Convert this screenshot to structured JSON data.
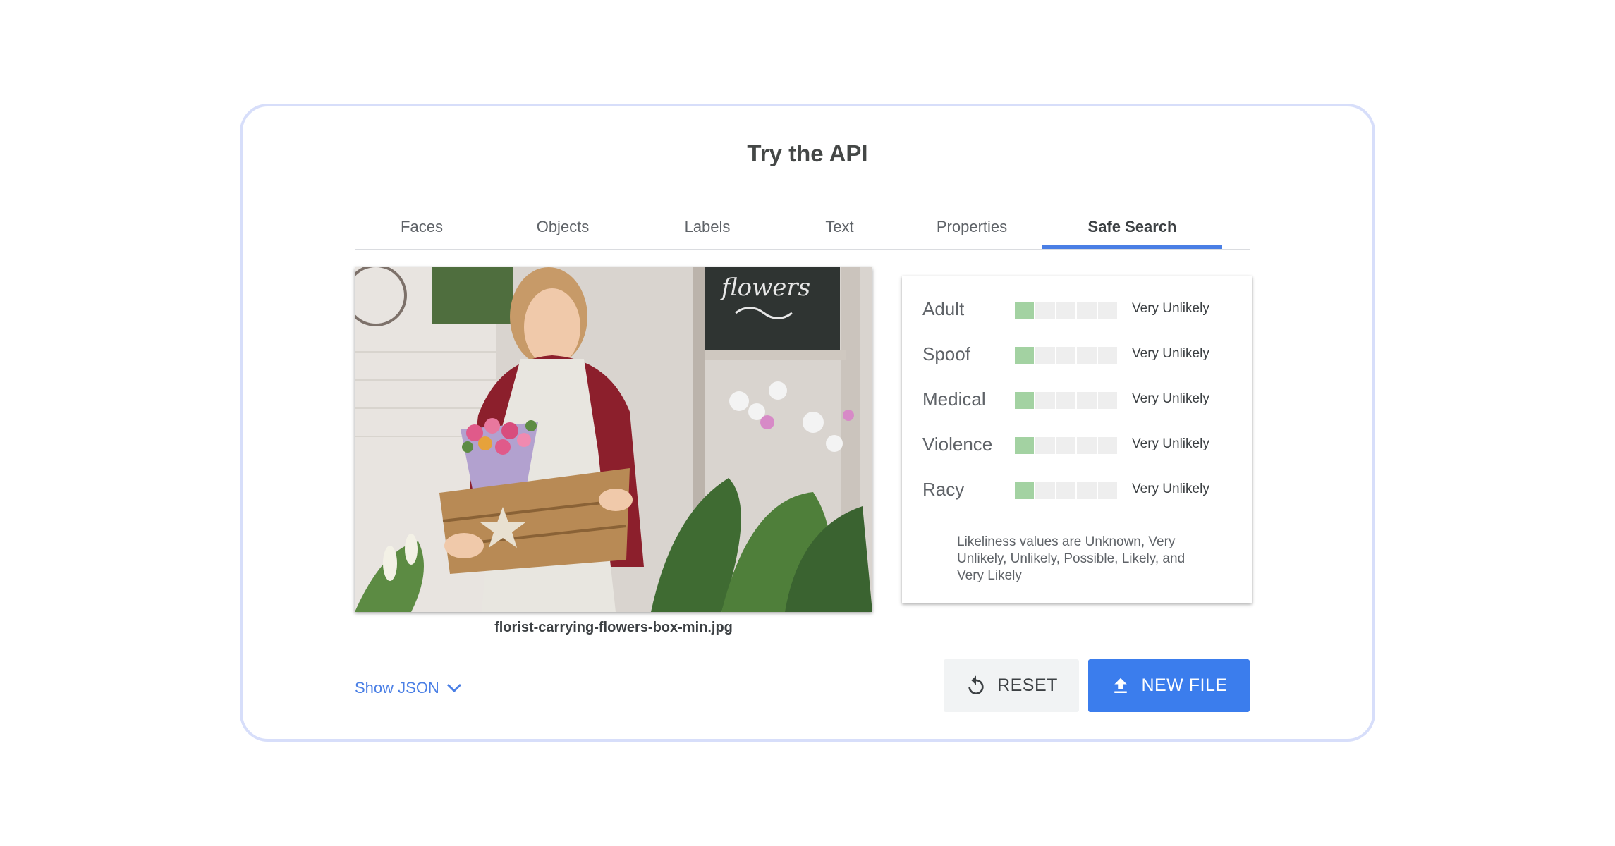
{
  "card": {
    "title": "Try the API"
  },
  "tabs": [
    {
      "label": "Faces",
      "active": false
    },
    {
      "label": "Objects",
      "active": false
    },
    {
      "label": "Labels",
      "active": false
    },
    {
      "label": "Text",
      "active": false
    },
    {
      "label": "Properties",
      "active": false
    },
    {
      "label": "Safe Search",
      "active": true
    }
  ],
  "image": {
    "filename": "florist-carrying-flowers-box-min.jpg",
    "icon": "florist-photo"
  },
  "safe_search": {
    "rows": [
      {
        "label": "Adult",
        "value": "Very Unlikely",
        "level": 1,
        "max_level": 5
      },
      {
        "label": "Spoof",
        "value": "Very Unlikely",
        "level": 1,
        "max_level": 5
      },
      {
        "label": "Medical",
        "value": "Very Unlikely",
        "level": 1,
        "max_level": 5
      },
      {
        "label": "Violence",
        "value": "Very Unlikely",
        "level": 1,
        "max_level": 5
      },
      {
        "label": "Racy",
        "value": "Very Unlikely",
        "level": 1,
        "max_level": 5
      }
    ],
    "note": "Likeliness values are Unknown, Very Unlikely, Unlikely, Possible, Likely, and Very Likely",
    "meter_on_color": "#a3d2a2",
    "meter_off_color": "#eeeeee"
  },
  "actions": {
    "show_json_label": "Show JSON",
    "show_json_icon": "chevron-down-icon",
    "reset_label": "RESET",
    "reset_icon": "reset-icon",
    "new_file_label": "NEW FILE",
    "new_file_icon": "upload-icon"
  },
  "colors": {
    "accent": "#4a7fe5",
    "primary_button": "#3b7ded",
    "card_border": "#d7defa"
  }
}
